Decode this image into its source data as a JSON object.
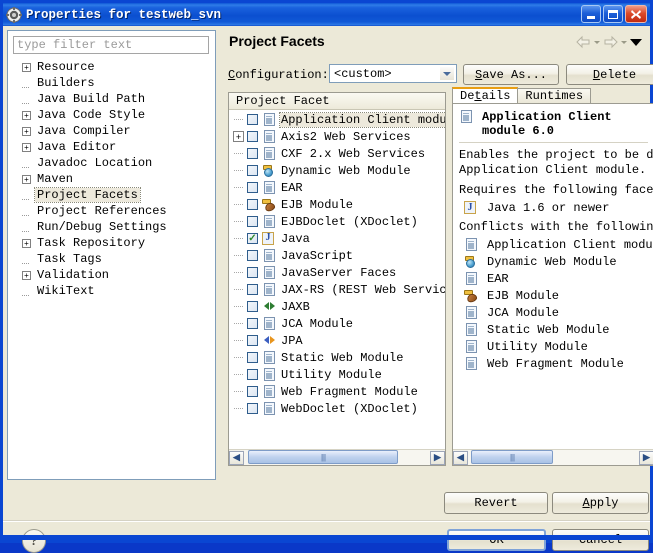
{
  "window": {
    "title": "Properties for testweb_svn",
    "icon": "gear-icon",
    "minimize_label": "Minimize",
    "maximize_label": "Maximize",
    "close_label": "Close"
  },
  "sidebar": {
    "filter_placeholder": "type filter text",
    "items": [
      {
        "label": "Resource",
        "expandable": true,
        "selected": false
      },
      {
        "label": "Builders",
        "expandable": false,
        "selected": false
      },
      {
        "label": "Java Build Path",
        "expandable": false,
        "selected": false
      },
      {
        "label": "Java Code Style",
        "expandable": true,
        "selected": false
      },
      {
        "label": "Java Compiler",
        "expandable": true,
        "selected": false
      },
      {
        "label": "Java Editor",
        "expandable": true,
        "selected": false
      },
      {
        "label": "Javadoc Location",
        "expandable": false,
        "selected": false
      },
      {
        "label": "Maven",
        "expandable": true,
        "selected": false
      },
      {
        "label": "Project Facets",
        "expandable": false,
        "selected": true
      },
      {
        "label": "Project References",
        "expandable": false,
        "selected": false
      },
      {
        "label": "Run/Debug Settings",
        "expandable": false,
        "selected": false
      },
      {
        "label": "Task Repository",
        "expandable": true,
        "selected": false
      },
      {
        "label": "Task Tags",
        "expandable": false,
        "selected": false
      },
      {
        "label": "Validation",
        "expandable": true,
        "selected": false
      },
      {
        "label": "WikiText",
        "expandable": false,
        "selected": false
      }
    ]
  },
  "page": {
    "title": "Project Facets",
    "nav": {
      "back_icon": "back-arrow-icon",
      "forward_icon": "forward-arrow-icon",
      "menu_icon": "chevron-down-icon"
    },
    "configuration": {
      "label": "Configuration:",
      "label_mnemonic": "C",
      "value": "<custom>"
    },
    "buttons": {
      "save_as": "Save As...",
      "save_as_mnemonic": "S",
      "delete": "Delete",
      "delete_mnemonic": "D"
    }
  },
  "facet_table": {
    "column_header": "Project Facet",
    "rows": [
      {
        "label": "Application Client module",
        "checked": false,
        "expandable": false,
        "icon": "document-icon",
        "selected": true
      },
      {
        "label": "Axis2 Web Services",
        "checked": false,
        "expandable": true,
        "icon": "document-icon",
        "selected": false
      },
      {
        "label": "CXF 2.x Web Services",
        "checked": false,
        "expandable": false,
        "icon": "document-icon",
        "selected": false
      },
      {
        "label": "Dynamic Web Module",
        "checked": false,
        "expandable": false,
        "icon": "web-module-icon",
        "selected": false
      },
      {
        "label": "EAR",
        "checked": false,
        "expandable": false,
        "icon": "document-icon",
        "selected": false
      },
      {
        "label": "EJB Module",
        "checked": false,
        "expandable": false,
        "icon": "ejb-module-icon",
        "selected": false
      },
      {
        "label": "EJBDoclet (XDoclet)",
        "checked": false,
        "expandable": false,
        "icon": "document-icon",
        "selected": false
      },
      {
        "label": "Java",
        "checked": true,
        "expandable": false,
        "icon": "java-icon",
        "selected": false
      },
      {
        "label": "JavaScript",
        "checked": false,
        "expandable": false,
        "icon": "document-icon",
        "selected": false
      },
      {
        "label": "JavaServer Faces",
        "checked": false,
        "expandable": false,
        "icon": "document-icon",
        "selected": false
      },
      {
        "label": "JAX-RS (REST Web Services)",
        "checked": false,
        "expandable": false,
        "icon": "document-icon",
        "selected": false
      },
      {
        "label": "JAXB",
        "checked": false,
        "expandable": false,
        "icon": "arrows-green-icon",
        "selected": false
      },
      {
        "label": "JCA Module",
        "checked": false,
        "expandable": false,
        "icon": "document-icon",
        "selected": false
      },
      {
        "label": "JPA",
        "checked": false,
        "expandable": false,
        "icon": "arrows-orange-icon",
        "selected": false
      },
      {
        "label": "Static Web Module",
        "checked": false,
        "expandable": false,
        "icon": "document-icon",
        "selected": false
      },
      {
        "label": "Utility Module",
        "checked": false,
        "expandable": false,
        "icon": "document-icon",
        "selected": false
      },
      {
        "label": "Web Fragment Module",
        "checked": false,
        "expandable": false,
        "icon": "document-icon",
        "selected": false
      },
      {
        "label": "WebDoclet (XDoclet)",
        "checked": false,
        "expandable": false,
        "icon": "document-icon",
        "selected": false
      }
    ],
    "scrollbar": {
      "left_arrow": "◀",
      "right_arrow": "▶"
    }
  },
  "details": {
    "tabs": [
      {
        "label": "Details",
        "mnemonic": "t",
        "active": true
      },
      {
        "label": "Runtimes",
        "mnemonic": "R",
        "active": false
      }
    ],
    "heading": "Application Client module 6.0",
    "heading_icon": "document-icon",
    "description_line1": "Enables the project to be de",
    "description_line2": "Application Client module.",
    "requires_heading": "Requires the following facet",
    "requires": [
      {
        "label": "Java 1.6 or newer",
        "icon": "java-icon"
      }
    ],
    "conflicts_heading": "Conflicts with the following",
    "conflicts": [
      {
        "label": "Application Client modul",
        "icon": "document-icon"
      },
      {
        "label": "Dynamic Web Module",
        "icon": "web-module-icon"
      },
      {
        "label": "EAR",
        "icon": "document-icon"
      },
      {
        "label": "EJB Module",
        "icon": "ejb-module-icon"
      },
      {
        "label": "JCA Module",
        "icon": "document-icon"
      },
      {
        "label": "Static Web Module",
        "icon": "document-icon"
      },
      {
        "label": "Utility Module",
        "icon": "document-icon"
      },
      {
        "label": "Web Fragment Module",
        "icon": "document-icon"
      }
    ],
    "scrollbar": {
      "left_arrow": "◀",
      "right_arrow": "▶"
    }
  },
  "footer": {
    "revert": "Revert",
    "apply": "Apply",
    "apply_mnemonic": "A",
    "ok": "OK",
    "cancel": "Cancel",
    "help_icon": "help-question-icon",
    "help_glyph": "?"
  },
  "colors": {
    "title_bar": "#0B4FD0",
    "dialog_background": "#ECE9D8",
    "selection": "#EDE9DC",
    "active_tab_top": "#E99E12",
    "check_green": "#2F8B2F"
  }
}
